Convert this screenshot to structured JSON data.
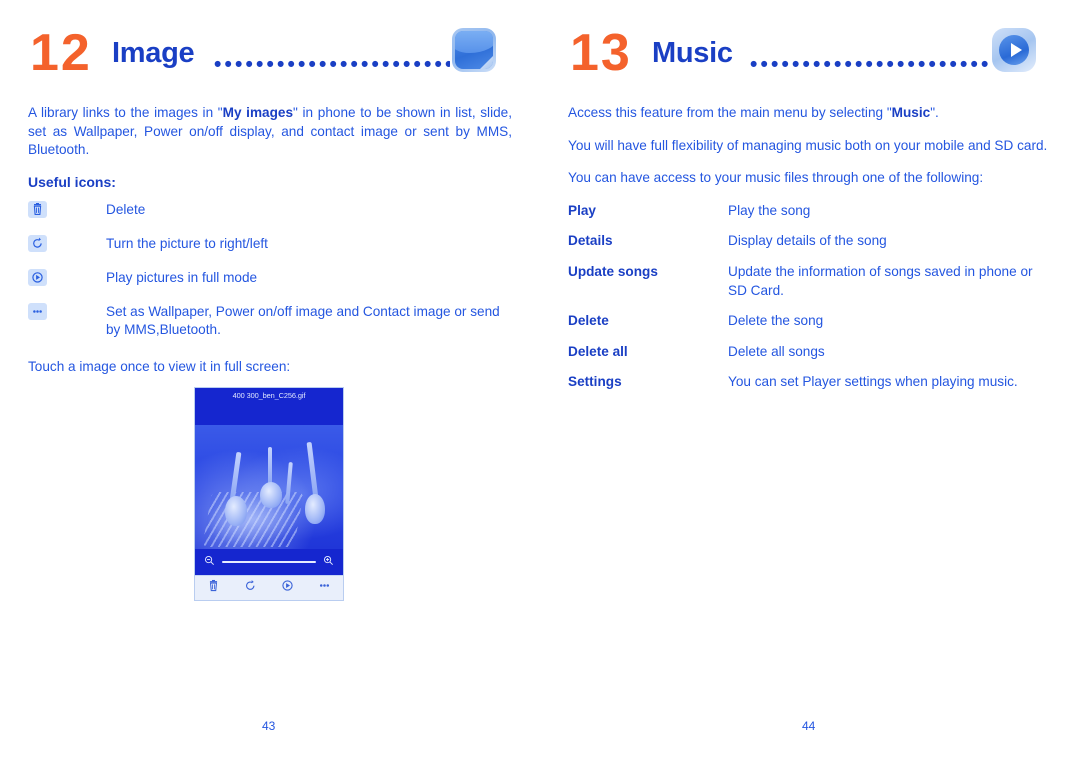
{
  "left_page": {
    "chapter_number": "12",
    "chapter_title": "Image",
    "leader_dots": "•••••••••••••••••••••••••••••",
    "icon_name": "image-picture-icon",
    "intro_parts": {
      "p1_before": "A library links to the images in \"",
      "p1_bold": "My images",
      "p1_after": "\" in phone to be shown in list, slide, set as Wallpaper, Power on/off display, and contact image or sent by MMS, Bluetooth."
    },
    "subhead": "Useful icons:",
    "icon_rows": [
      {
        "icon": "trash-delete-icon",
        "text": "Delete"
      },
      {
        "icon": "rotate-right-icon",
        "text": "Turn the picture to right/left"
      },
      {
        "icon": "play-circle-icon",
        "text": "Play pictures in full mode"
      },
      {
        "icon": "more-dots-icon",
        "text": "Set as Wallpaper, Power on/off image and Contact image or send by MMS,Bluetooth."
      }
    ],
    "shot_caption": "Touch a image once to view it in full screen:",
    "screenshot": {
      "filename": "400 300_ben_C256.gif",
      "zoom_out_icon": "zoom-out-icon",
      "zoom_in_icon": "zoom-in-icon",
      "toolbar_icons": [
        "trash-delete-icon",
        "rotate-right-icon",
        "play-circle-icon",
        "more-dots-icon"
      ]
    },
    "folio": "43"
  },
  "right_page": {
    "chapter_number": "13",
    "chapter_title": "Music",
    "leader_dots": "•••••••••••••••••••••••••••••",
    "icon_name": "music-play-icon",
    "paragraphs": {
      "p1_before": "Access this feature from the main menu by selecting \"",
      "p1_bold": "Music",
      "p1_after": "\".",
      "p2": "You will have full flexibility of managing music both on your mobile and SD card.",
      "p3": "You can have access to your music files through one of the following:"
    },
    "definitions": [
      {
        "term": "Play",
        "desc": "Play the song"
      },
      {
        "term": "Details",
        "desc": "Display details of the song"
      },
      {
        "term": "Update songs",
        "desc": "Update the information of songs saved in phone or SD Card."
      },
      {
        "term": "Delete",
        "desc": "Delete the song"
      },
      {
        "term": "Delete all",
        "desc": "Delete all songs"
      },
      {
        "term": "Settings",
        "desc": "You can set Player settings when playing music."
      }
    ],
    "folio": "44"
  },
  "colors": {
    "chapter_number": "#F4622C",
    "heading_blue": "#1A3FC4",
    "body_blue": "#2456E0",
    "icon_chip": "#CFE0FB"
  }
}
